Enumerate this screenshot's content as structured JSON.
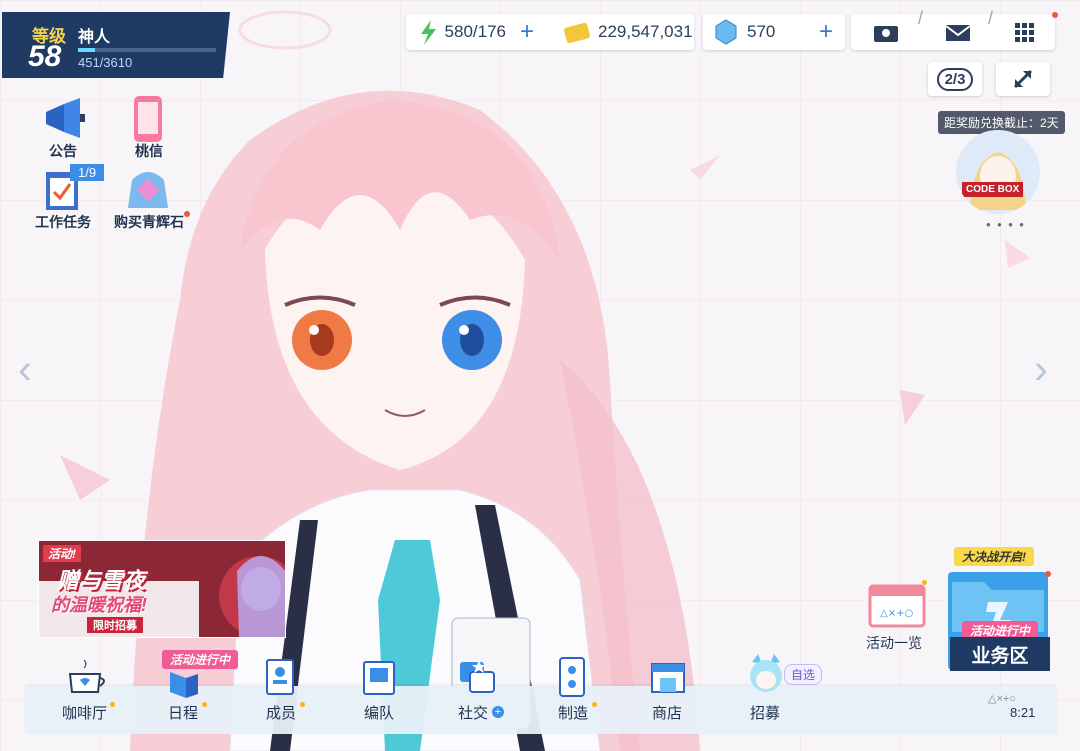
{
  "player": {
    "level_word": "等级",
    "level": "58",
    "name": "神人",
    "exp_text": "451/3610",
    "exp_fraction": 0.125
  },
  "resources": {
    "stamina": "580/176",
    "credits": "229,547,031",
    "gems": "570"
  },
  "top_right": {
    "page_indicator": "2/3",
    "reward_deadline": "距奖励兑换截止：2天",
    "banner_logo_text": "CODE BOX"
  },
  "shortcuts": [
    {
      "label": "公告",
      "icon": "megaphone-icon"
    },
    {
      "label": "桃信",
      "icon": "phone-icon"
    },
    {
      "label": "工作任务",
      "icon": "task-clipboard-icon",
      "badge": "1/9"
    },
    {
      "label": "购买青辉石",
      "icon": "pyroxene-bag-icon"
    }
  ],
  "event_banner": {
    "tag": "活动!",
    "title_line1": "赠与雪夜",
    "title_line2": "的温暖祝福!",
    "sub": "限时招募"
  },
  "right_panel": {
    "activity_list_label": "活动一览",
    "battle_tag": "大决战开启!",
    "ongoing_tag": "活动进行中",
    "business_label": "业务区"
  },
  "dock": {
    "items": [
      {
        "label": "咖啡厅",
        "icon": "cafe-cup-icon"
      },
      {
        "label": "日程",
        "icon": "schedule-icon",
        "tag": "活动进行中"
      },
      {
        "label": "成员",
        "icon": "members-icon"
      },
      {
        "label": "编队",
        "icon": "formation-icon"
      },
      {
        "label": "社交",
        "icon": "social-icon"
      },
      {
        "label": "制造",
        "icon": "crafting-icon"
      },
      {
        "label": "商店",
        "icon": "shop-icon"
      },
      {
        "label": "招募",
        "icon": "recruit-icon",
        "tag": "自选"
      }
    ],
    "time": "8:21",
    "symbols": "△×+○"
  },
  "colors": {
    "panel_navy": "#1f3a63",
    "accent_blue": "#3a77c8",
    "pink": "#f25b93",
    "level_gold": "#f3d34d"
  }
}
